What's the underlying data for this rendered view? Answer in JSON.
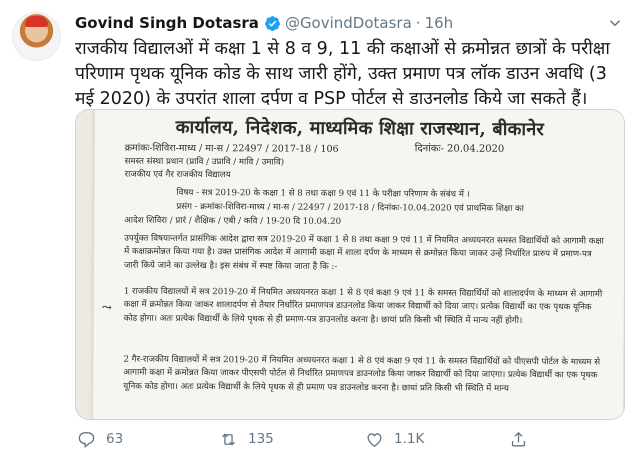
{
  "tweet": {
    "author_name": "Govind Singh Dotasra",
    "handle": "@GovindDotasra",
    "separator": "·",
    "time": "16h",
    "text": "राजकीय विद्यालओं में कक्षा 1 से 8 व 9, 11 की कक्षाओं से क्रमोन्नत छात्रों के परीक्षा परिणाम पृथक यूनिक कोड के साथ जारी होंगे, उक्त प्रमाण पत्र लॉक डाउन अवधि (3 मई 2020) के उपरांत शाला दर्पण व PSP पोर्टल से डाउनलोड किये जा सकते हैं।"
  },
  "document": {
    "title": "कार्यालय, निदेशक, माध्यमिक शिक्षा राजस्थान, बीकानेर",
    "ref": "क्रमांकः-शिविरा-माध्य / मा-स / 22497 / 2017-18 / 106",
    "date": "दिनांकः- 20.04.2020",
    "to1": "समस्त संस्था प्रधान (प्रावि / उप्रावि / मावि / उमावि)",
    "to2": "राजकीय एवं गैर राजकीय विद्यालय",
    "subject": "विषय - सत्र 2019-20 के कक्षा 1 से 8 तथा कक्षा 9 एवं 11 के परीक्षा परिणाम के संबंध में ।",
    "reference1": "प्रसंग - क्रमांकः-शिविरा-माध्य / मा-स / 22497 / 2017-18 / दिनांकः-10.04.2020 एवं प्राथमिक शिक्षा का",
    "reference2": "आदेश शिविरा / प्रारं / शैक्षिक / एबी / कवि / 19-20 दि 10.04.20",
    "para1": "उपर्युक्त विषयान्तर्गत प्रासंगिक आदेश द्वारा सत्र 2019-20 में कक्षा 1 से 8 तथा कक्षा 9 एवं 11 में नियमित अध्ययनरत समस्त विद्यार्थियों को आगामी कक्षा में कक्षाक्रमोन्नत किया गया है। उक्त प्रासंगिक आदेश में आगामी कक्षा में शाला दर्पण के माध्यम से क्रमोन्नत किया जाकर उन्हें निर्धारित प्रारुप में प्रमाण-पत्र जारी किये जाने का उल्लेख है। इस संबंध में स्पष्ट किया जाता है कि :-",
    "point1": "1 राजकीय विद्यालयों में सत्र 2019-20 में नियमित अध्ययनरत कक्षा 1 से 8 एवं कक्षा 9 एवं 11 के समस्त विद्यार्थियों को शालादर्पण के माध्यम से आगामी कक्षा में क्रमोन्नत किया जाकर शालादर्पण से तैयार निर्धारित प्रमाणपत्र डाउनलोड किया जाकर विद्यार्थी को दिया जाए। प्रत्येक विद्यार्थी का एक पृथक यूनिक कोड होगा। अतः प्रत्येक विद्यार्थी के लिये पृथक से ही प्रमाण-पत्र डाउनलोड करना है। छायां प्रति किसी भी स्थिति में मान्य नहीं होगी।",
    "point2": "2 गैर-राजकीय विद्यालयों में सत्र 2019-20 में नियमित अध्ययनरत कक्षा 1 से 8 एवं कक्षा 9 एवं 11 के समस्त विद्यार्थियों को पीएसपी पोर्टल के माध्यम से आगामी कक्षा में क्रमोन्नत किया जाकर पीएसपी पोर्टल से निर्धारित प्रमाणपत्र डाउनलोड किया जाकर विद्यार्थी को दिया जाएगा। प्रत्येक विद्यार्थी का एक पृथक यूनिक कोड होगा। अतः प्रत्येक विद्यार्थी के लिये पृथक से ही प्रमाण पत्र डाउनलोड करना है। छायां प्रति किसी भी स्थिति में मान्य"
  },
  "actions": {
    "reply_count": "63",
    "retweet_count": "135",
    "like_count": "1.1K"
  },
  "colors": {
    "text": "#14171a",
    "secondary": "#657786",
    "verified": "#1da1f2",
    "border": "#ccd6dd"
  },
  "icons": [
    "verified-badge-icon",
    "caret-down-icon",
    "reply-icon",
    "retweet-icon",
    "like-icon",
    "share-icon"
  ]
}
